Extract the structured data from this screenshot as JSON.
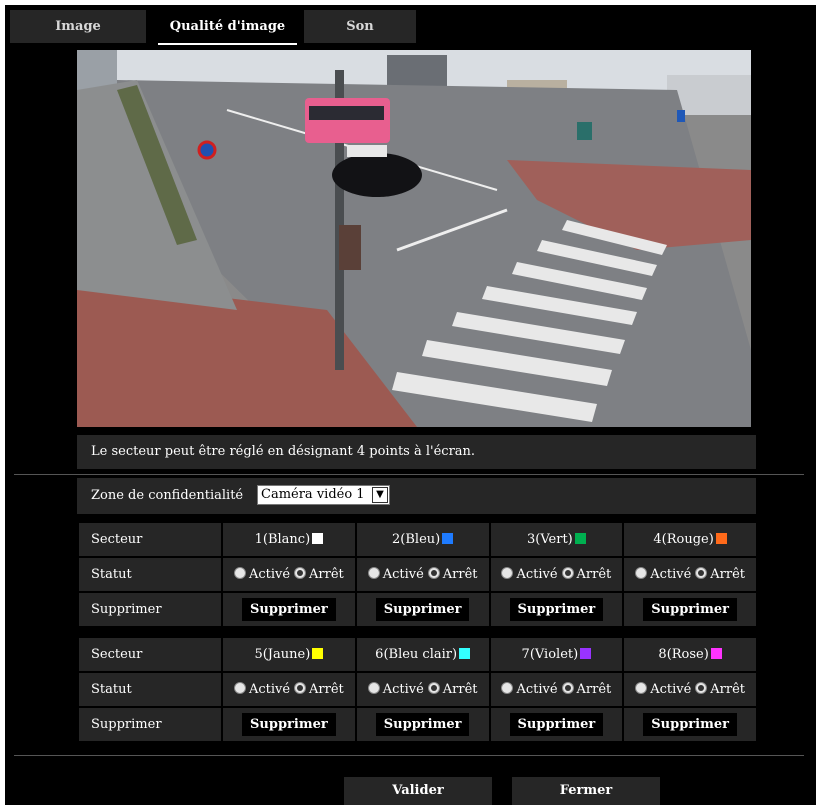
{
  "tabs": [
    {
      "label": "Image"
    },
    {
      "label": "Qualité d'image"
    },
    {
      "label": "Son"
    }
  ],
  "camera": {
    "description": "camera-feed"
  },
  "info_text": "Le secteur peut être réglé en désignant 4 points à l'écran.",
  "zone": {
    "label": "Zone de confidentialité",
    "selected": "Caméra vidéo 1"
  },
  "labels": {
    "secteur": "Secteur",
    "statut": "Statut",
    "supprimer": "Supprimer",
    "active": "Activé",
    "arret": "Arrêt",
    "delete_button": "Supprimer"
  },
  "sectors_group1": [
    {
      "name": "1(Blanc)",
      "color": "#ffffff"
    },
    {
      "name": "2(Bleu)",
      "color": "#1e7bff"
    },
    {
      "name": "3(Vert)",
      "color": "#00b050"
    },
    {
      "name": "4(Rouge)",
      "color": "#ff6a1a"
    }
  ],
  "sectors_group2": [
    {
      "name": "5(Jaune)",
      "color": "#ffff00"
    },
    {
      "name": "6(Bleu clair)",
      "color": "#33ffff"
    },
    {
      "name": "7(Violet)",
      "color": "#9933ff"
    },
    {
      "name": "8(Rose)",
      "color": "#ff33ff"
    }
  ],
  "footer": {
    "validate": "Valider",
    "close": "Fermer"
  }
}
